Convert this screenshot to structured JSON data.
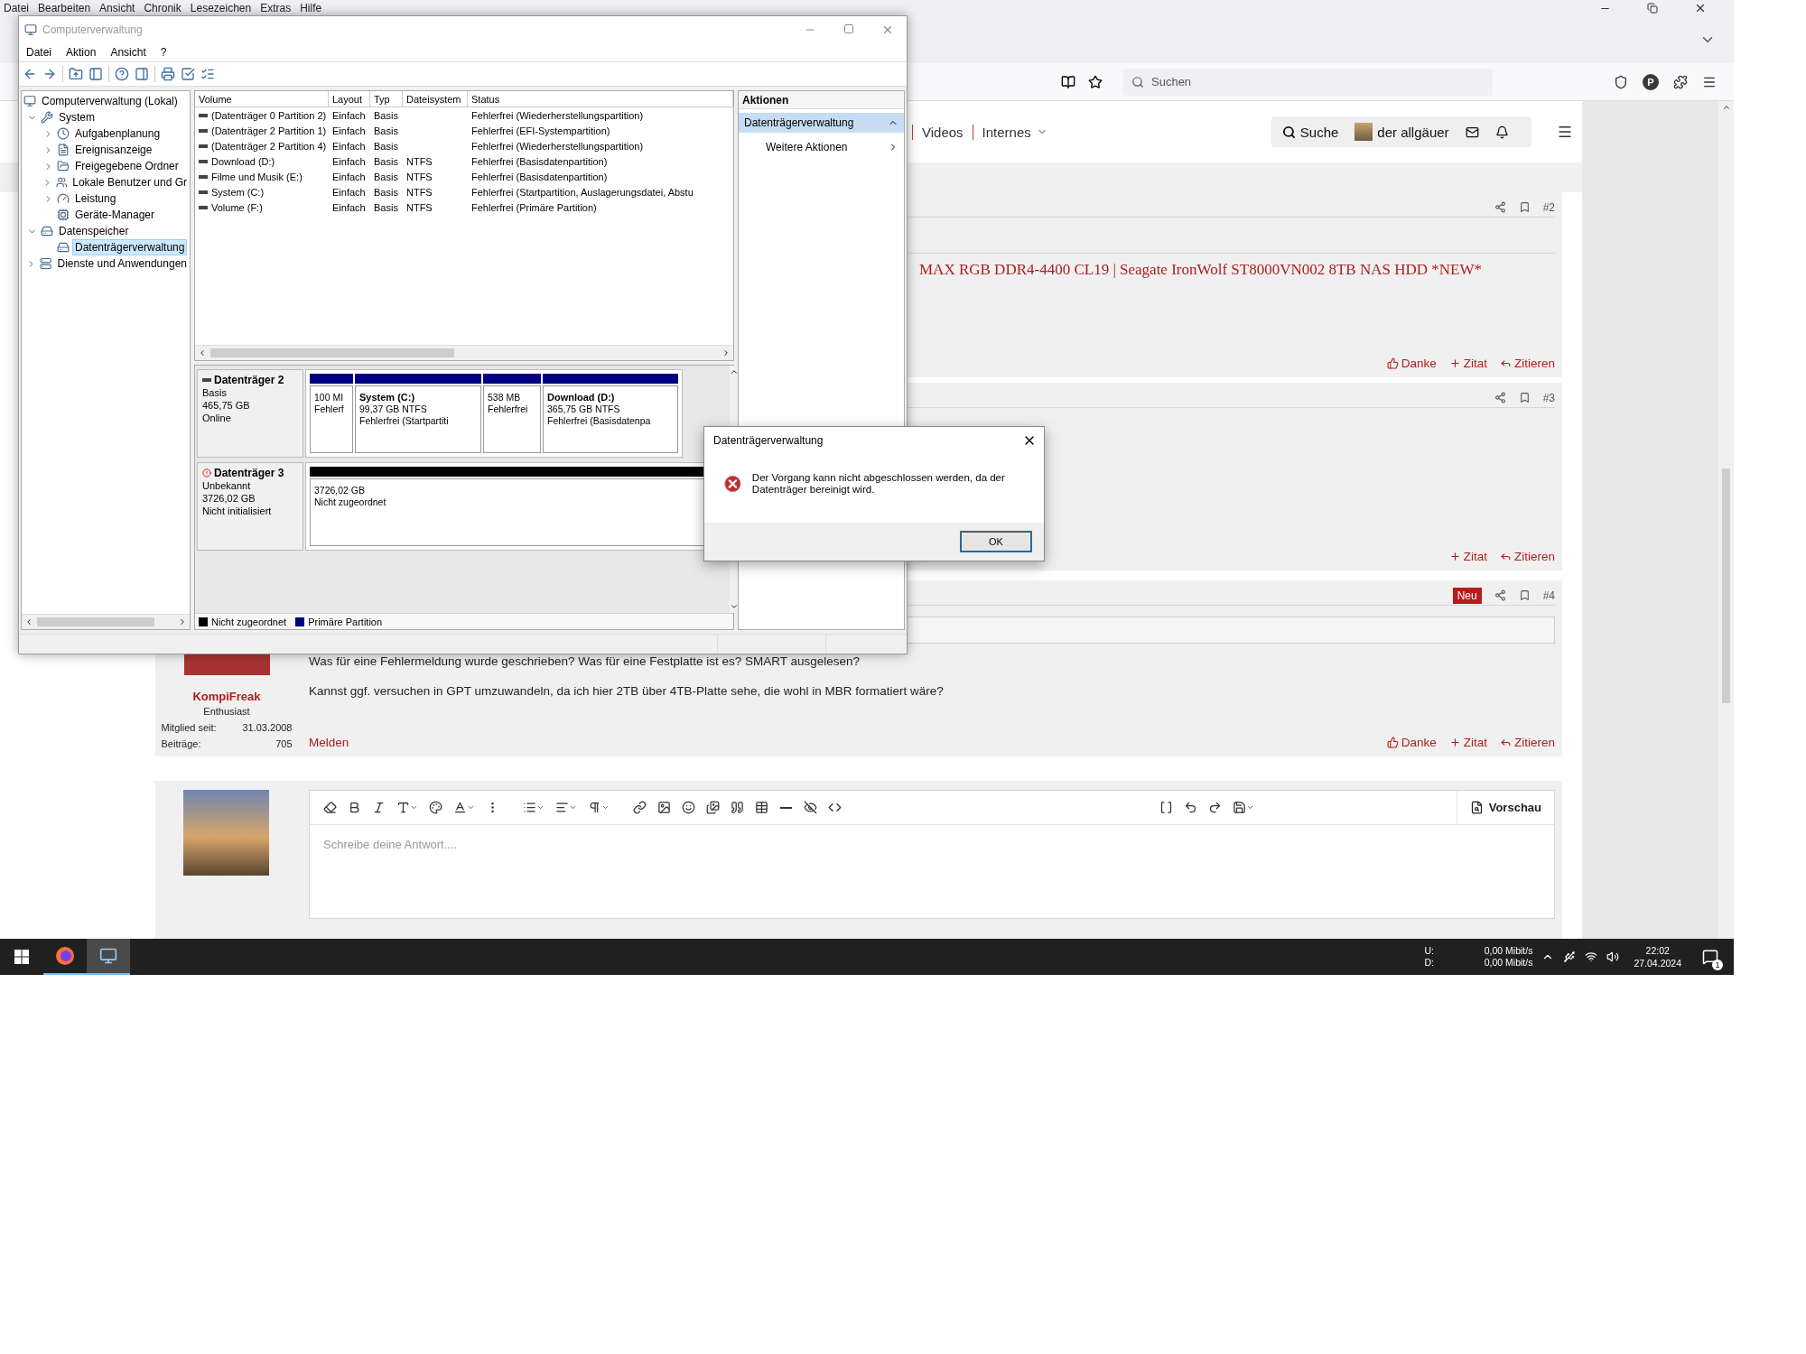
{
  "browser": {
    "menu": [
      "Datei",
      "Bearbeiten",
      "Ansicht",
      "Chronik",
      "Lesezeichen",
      "Extras",
      "Hilfe"
    ],
    "search": {
      "placeholder": "Suchen"
    },
    "profile_initial": "P"
  },
  "forum": {
    "nav": [
      {
        "label": "Videos",
        "dropdown": false
      },
      {
        "label": "Internes",
        "dropdown": true
      }
    ],
    "search_label": "Suche",
    "username": "der allgäuer",
    "posts": [
      {
        "number": "#2",
        "new": false,
        "signature": "MAX RGB DDR4-4400 CL19 | Seagate IronWolf ST8000VN002 8TB NAS HDD *NEW*",
        "actions": [
          {
            "kind": "like",
            "label": "Danke"
          },
          {
            "kind": "quote",
            "label": "Zitat"
          },
          {
            "kind": "reply",
            "label": "Zitieren"
          }
        ]
      },
      {
        "number": "#3",
        "new": false,
        "actions": [
          {
            "kind": "quote",
            "label": "Zitat"
          },
          {
            "kind": "reply",
            "label": "Zitieren"
          }
        ]
      },
      {
        "number": "#4",
        "new": true,
        "new_label": "Neu",
        "author": {
          "name": "KompiFreak",
          "rank": "Enthusiast",
          "stats": [
            {
              "label": "Mitglied seit:",
              "value": "31.03.2008"
            },
            {
              "label": "Beiträge:",
              "value": "705"
            }
          ]
        },
        "quote_box": true,
        "paragraphs": [
          "Was für eine Fehlermeldung wurde geschrieben? Was für eine Festplatte ist es? SMART ausgelesen?",
          "Kannst ggf. versuchen in GPT umzuwandeln, da ich hier 2TB über 4TB-Platte sehe, die wohl in MBR formatiert wäre?"
        ],
        "report": "Melden",
        "actions": [
          {
            "kind": "like",
            "label": "Danke"
          },
          {
            "kind": "quote",
            "label": "Zitat"
          },
          {
            "kind": "reply",
            "label": "Zitieren"
          }
        ]
      }
    ],
    "editor": {
      "placeholder": "Schreibe deine Antwort....",
      "preview": "Vorschau"
    }
  },
  "computer_management": {
    "title": "Computerverwaltung",
    "menu": [
      "Datei",
      "Aktion",
      "Ansicht",
      "?"
    ],
    "tree": [
      {
        "label": "Computerverwaltung (Lokal)",
        "kind": "computer",
        "selected": false,
        "children": [
          {
            "label": "System",
            "kind": "tools",
            "expanded": true,
            "selected": false,
            "children": [
              {
                "label": "Aufgabenplanung",
                "kind": "clock",
                "expanded": false,
                "selected": false
              },
              {
                "label": "Ereignisanzeige",
                "kind": "log",
                "expanded": false,
                "selected": false
              },
              {
                "label": "Freigegebene Ordner",
                "kind": "folder",
                "expanded": false,
                "selected": false
              },
              {
                "label": "Lokale Benutzer und Gr",
                "kind": "users",
                "expanded": false,
                "selected": false
              },
              {
                "label": "Leistung",
                "kind": "gauge",
                "expanded": false,
                "selected": false
              },
              {
                "label": "Geräte-Manager",
                "kind": "device",
                "selected": false
              }
            ]
          },
          {
            "label": "Datenspeicher",
            "kind": "storage",
            "expanded": true,
            "selected": false,
            "children": [
              {
                "label": "Datenträgerverwaltung",
                "kind": "disk",
                "selected": true
              }
            ]
          },
          {
            "label": "Dienste und Anwendungen",
            "kind": "services",
            "expanded": false,
            "selected": false
          }
        ]
      }
    ],
    "volumes": {
      "columns": [
        "Volume",
        "Layout",
        "Typ",
        "Dateisystem",
        "Status"
      ],
      "rows": [
        [
          "(Datenträger 0 Partition 2)",
          "Einfach",
          "Basis",
          "",
          "Fehlerfrei (Wiederherstellungspartition)"
        ],
        [
          "(Datenträger 2 Partition 1)",
          "Einfach",
          "Basis",
          "",
          "Fehlerfrei (EFI-Systempartition)"
        ],
        [
          "(Datenträger 2 Partition 4)",
          "Einfach",
          "Basis",
          "",
          "Fehlerfrei (Wiederherstellungspartition)"
        ],
        [
          "Download (D:)",
          "Einfach",
          "Basis",
          "NTFS",
          "Fehlerfrei (Basisdatenpartition)"
        ],
        [
          "Filme und Musik (E:)",
          "Einfach",
          "Basis",
          "NTFS",
          "Fehlerfrei (Basisdatenpartition)"
        ],
        [
          "System (C:)",
          "Einfach",
          "Basis",
          "NTFS",
          "Fehlerfrei (Startpartition, Auslagerungsdatei, Abstu"
        ],
        [
          "Volume (F:)",
          "Einfach",
          "Basis",
          "NTFS",
          "Fehlerfrei (Primäre Partition)"
        ]
      ]
    },
    "disks": [
      {
        "name": "Datenträger 2",
        "alert": false,
        "details": [
          "Basis",
          "465,75 GB",
          "Online"
        ],
        "partitions": [
          {
            "kind": "primary",
            "lines": [
              "100 MI",
              "Fehlerf"
            ]
          },
          {
            "kind": "primary",
            "name": "System  (C:)",
            "lines": [
              "99,37 GB NTFS",
              "Fehlerfrei (Startpartiti"
            ]
          },
          {
            "kind": "primary",
            "lines": [
              "538 MB",
              "Fehlerfrei"
            ]
          },
          {
            "kind": "primary",
            "name": "Download  (D:)",
            "lines": [
              "365,75 GB NTFS",
              "Fehlerfrei (Basisdatenpa"
            ]
          }
        ]
      },
      {
        "name": "Datenträger 3",
        "alert": true,
        "details": [
          "Unbekannt",
          "3726,02 GB",
          "Nicht initialisiert"
        ],
        "partitions": [
          {
            "kind": "unallocated",
            "lines": [
              "3726,02 GB",
              "Nicht zugeordnet"
            ]
          }
        ]
      }
    ],
    "legend": [
      {
        "label": "Nicht zugeordnet",
        "color": "#000000"
      },
      {
        "label": "Primäre Partition",
        "color": "#000080"
      }
    ],
    "actions": {
      "title": "Aktionen",
      "items": [
        {
          "kind": "section",
          "label": "Datenträgerverwaltung",
          "selected": true
        },
        {
          "kind": "submenu",
          "label": "Weitere Aktionen",
          "selected": false
        }
      ]
    }
  },
  "dialog": {
    "title": "Datenträgerverwaltung",
    "message": "Der Vorgang kann nicht abgeschlossen werden, da der Datenträger bereinigt wird.",
    "button": "OK"
  },
  "taskbar": {
    "apps": [
      {
        "kind": "firefox",
        "focused": false
      },
      {
        "kind": "computer-management",
        "focused": true
      }
    ],
    "network": [
      {
        "label": "U:",
        "value": "0,00 Mibit/s"
      },
      {
        "label": "D:",
        "value": "0,00 Mibit/s"
      }
    ],
    "time": "22:02",
    "date": "27.04.2024",
    "notifications": "1"
  }
}
